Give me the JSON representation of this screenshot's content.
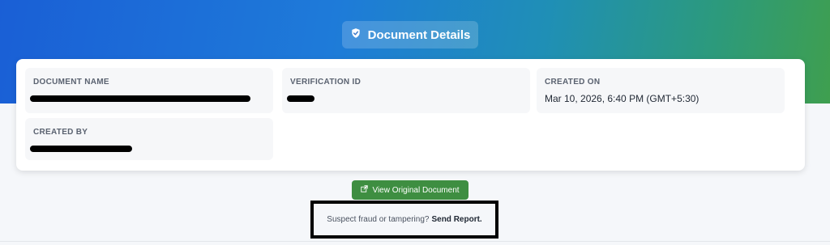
{
  "header": {
    "title": "Document Details",
    "title_icon": "shield-check-icon"
  },
  "fields": {
    "document_name": {
      "label": "DOCUMENT NAME",
      "value": ""
    },
    "verification_id": {
      "label": "VERIFICATION ID",
      "value": ""
    },
    "created_on": {
      "label": "CREATED ON",
      "value": "Mar 10, 2026, 6:40 PM (GMT+5:30)"
    },
    "created_by": {
      "label": "CREATED BY",
      "value": ""
    }
  },
  "actions": {
    "view_original_label": "View Original Document",
    "view_original_icon": "external-link-icon"
  },
  "report": {
    "prompt": "Suspect fraud or tampering?",
    "link_label": "Send Report."
  },
  "colors": {
    "gradient_start": "#1a5fd6",
    "gradient_end": "#3f9f4f",
    "button_green": "#3e8e41"
  }
}
